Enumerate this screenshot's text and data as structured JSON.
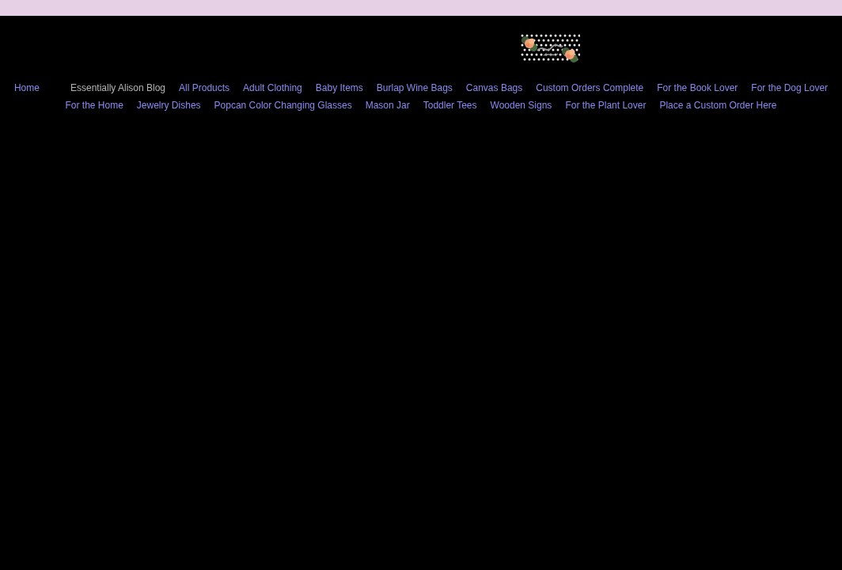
{
  "nav": {
    "items": [
      {
        "label": "Home",
        "selected": false
      },
      {
        "label": "Essentially Alison Blog",
        "selected": true
      },
      {
        "label": "All Products",
        "selected": false
      },
      {
        "label": "Adult Clothing",
        "selected": false
      },
      {
        "label": "Baby Items",
        "selected": false
      },
      {
        "label": "Burlap Wine Bags",
        "selected": false
      },
      {
        "label": "Canvas Bags",
        "selected": false
      },
      {
        "label": "Custom Orders Complete",
        "selected": false
      },
      {
        "label": "For the Book Lover",
        "selected": false
      },
      {
        "label": "For the Dog Lover",
        "selected": false
      },
      {
        "label": "For the Home",
        "selected": false
      },
      {
        "label": "Jewelry Dishes",
        "selected": false
      },
      {
        "label": "Popcan Color Changing Glasses",
        "selected": false
      },
      {
        "label": "Mason Jar",
        "selected": false
      },
      {
        "label": "Toddler Tees",
        "selected": false
      },
      {
        "label": "Wooden Signs",
        "selected": false
      },
      {
        "label": "For the Plant Lover",
        "selected": false
      },
      {
        "label": "Place a Custom Order Here",
        "selected": false
      }
    ]
  }
}
